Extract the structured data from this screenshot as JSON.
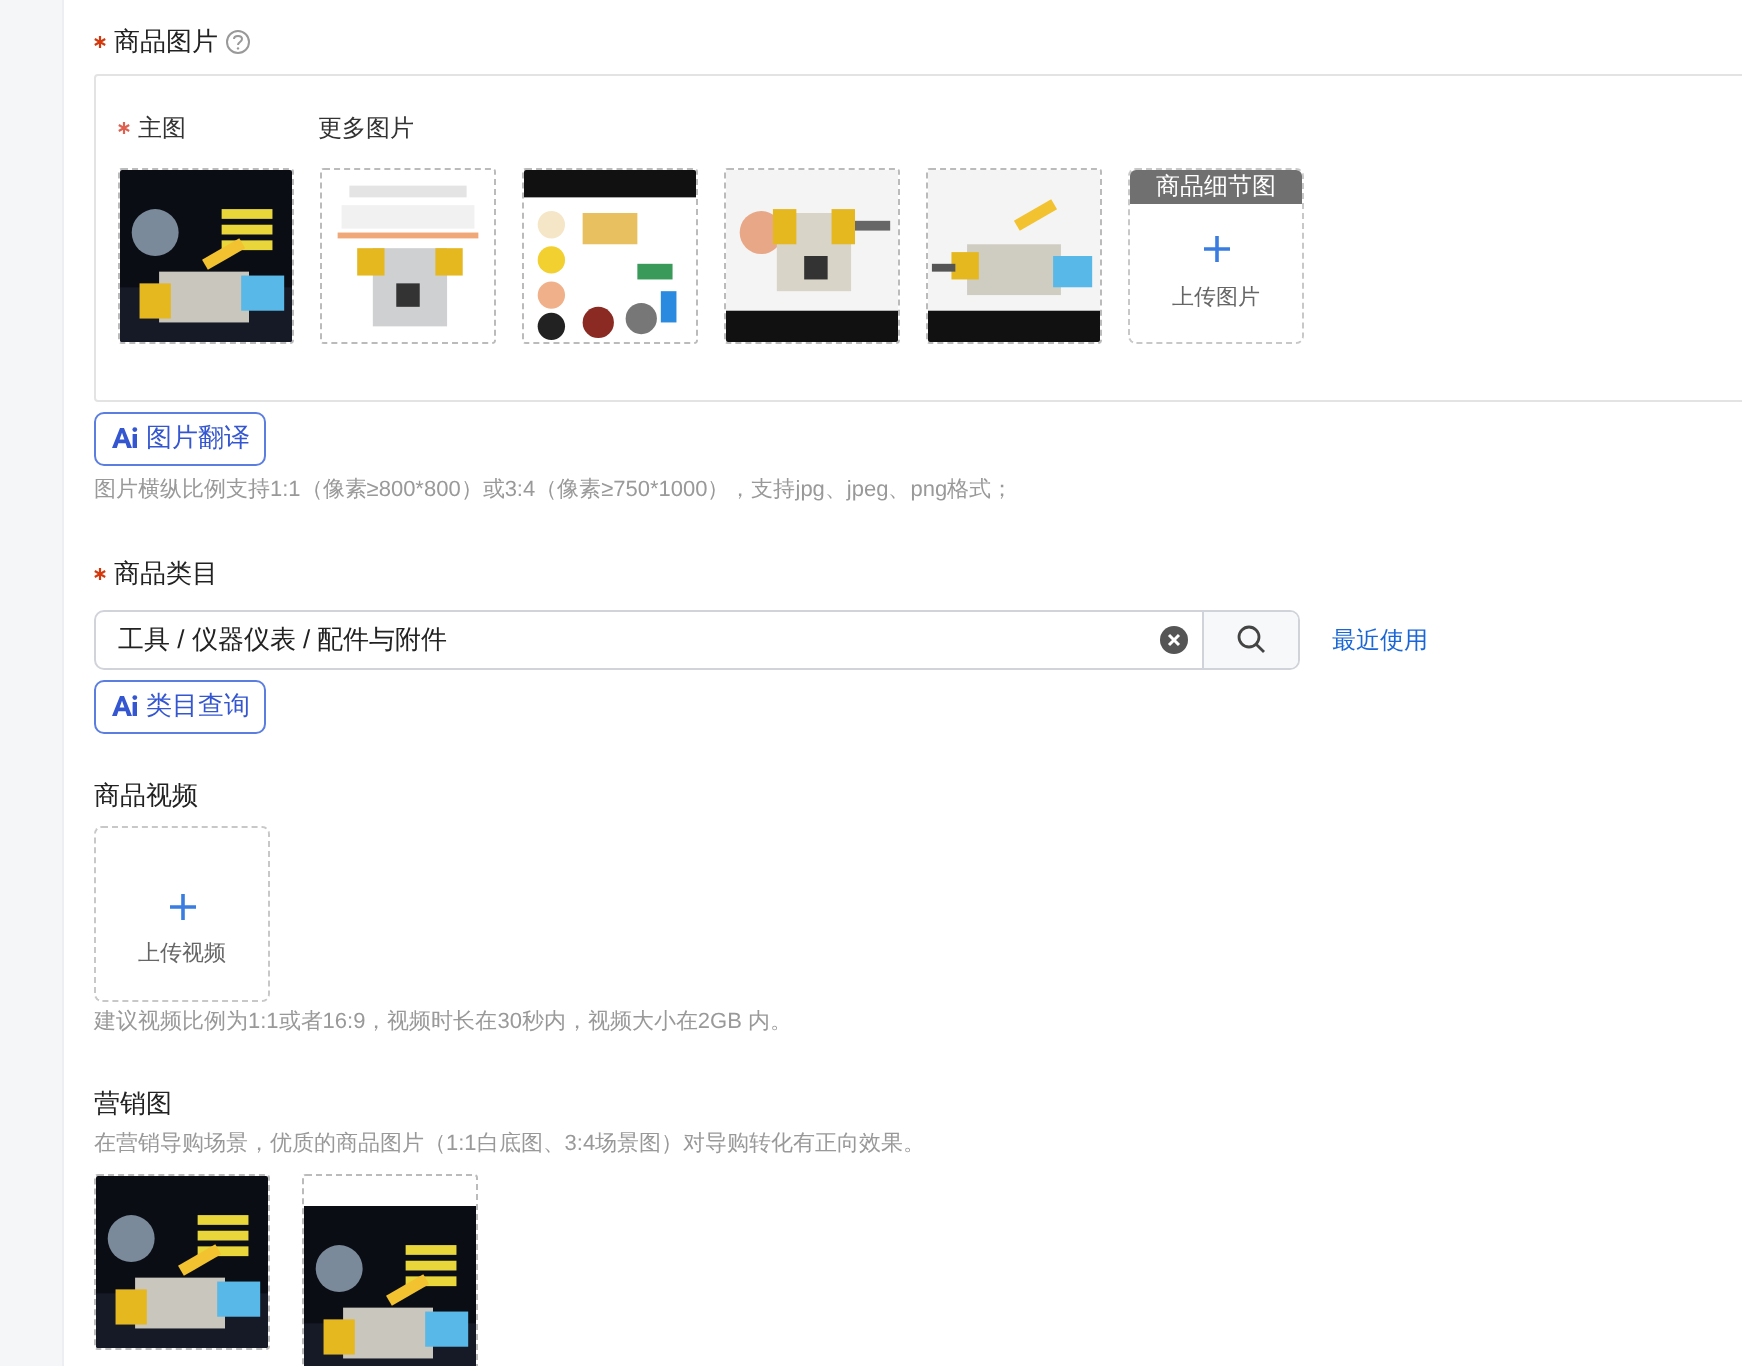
{
  "images_section": {
    "label": "商品图片",
    "required": true,
    "main_label": "主图",
    "main_required": true,
    "more_label": "更多图片",
    "detail_upload": {
      "badge": "商品细节图",
      "text": "上传图片"
    },
    "ai_button": "图片翻译",
    "hint": "图片横纵比例支持1:1（像素≥800*800）或3:4（像素≥750*1000），支持jpg、jpeg、png格式；"
  },
  "category_section": {
    "label": "商品类目",
    "required": true,
    "value": "工具 / 仪器仪表 / 配件与附件",
    "recent_link": "最近使用",
    "ai_button": "类目查询"
  },
  "video_section": {
    "label": "商品视频",
    "upload_text": "上传视频",
    "hint": "建议视频比例为1:1或者16:9，视频时长在30秒内，视频大小在2GB 内。"
  },
  "marketing_section": {
    "label": "营销图",
    "hint": "在营销导购场景，优质的商品图片（1:1白底图、3:4场景图）对导购转化有正向效果。"
  }
}
